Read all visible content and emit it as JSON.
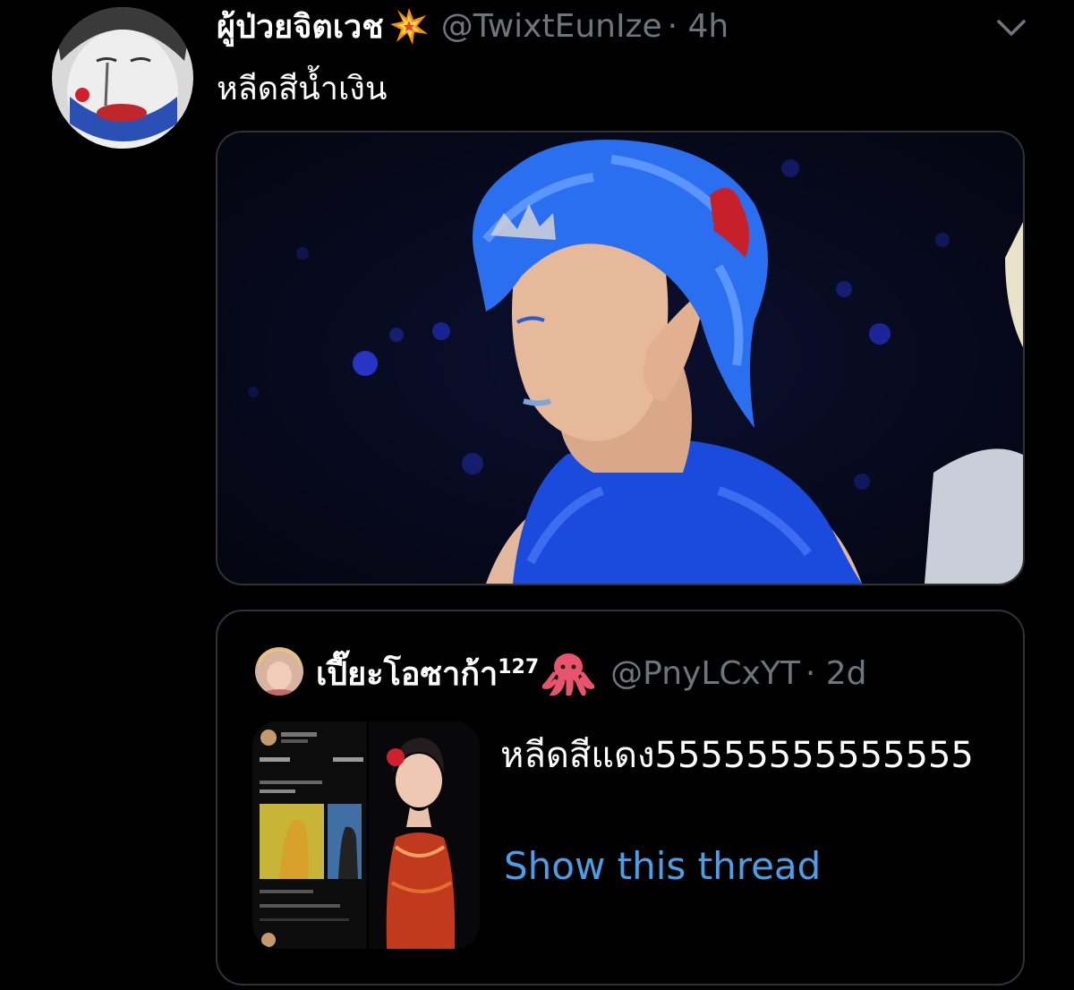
{
  "tweet": {
    "author_name": "ผู้ป่วยจิตเวช",
    "author_emoji": "collision-emoji",
    "handle": "@TwixtEunIze",
    "time": "· 4h",
    "text": "หลีดสีน้ำเงิน",
    "menu_icon": "chevron-down-icon"
  },
  "quote": {
    "author_name": "เปี๊ยะโอซาก้า",
    "author_sup": "127",
    "author_emoji": "octopus-emoji",
    "handle": "@PnyLCxYT",
    "time": "· 2d",
    "text": "หลีดสีแดง55555555555555",
    "show_thread": "Show this thread"
  },
  "colors": {
    "background": "#000000",
    "border": "#2f3336",
    "secondary_text": "#6e767d",
    "link": "#4a9fe8"
  }
}
